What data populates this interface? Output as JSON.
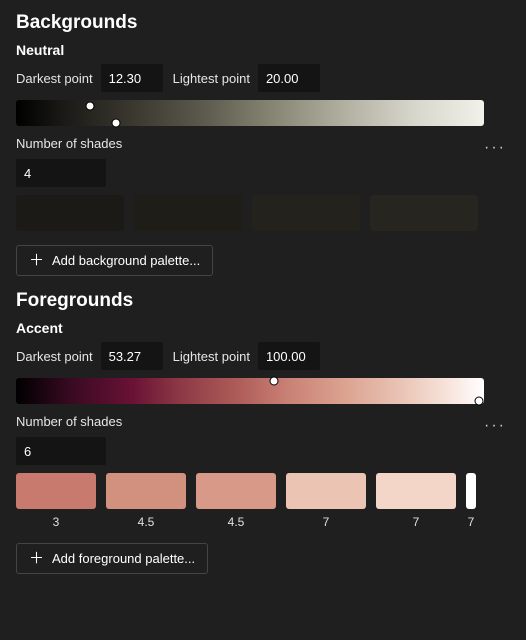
{
  "backgrounds": {
    "title": "Backgrounds",
    "palette_name": "Neutral",
    "darkest_label": "Darkest point",
    "darkest_value": "12.30",
    "lightest_label": "Lightest point",
    "lightest_value": "20.00",
    "shades_label": "Number of shades",
    "shades_value": "4",
    "add_button": "Add background palette...",
    "gradient_css": "linear-gradient(90deg,#000000 0%,#1a1916 10%,#3a382f 25%,#5c5a4d 40%,#878573 55%,#b1afa0 70%,#d7d6cb 85%,#f2f1ea 100%)",
    "handle1_x": "74",
    "handle1_y": "6",
    "handle2_x": "100",
    "handle2_y": "23",
    "swatches": [
      {
        "color": "#1b1a17"
      },
      {
        "color": "#1f1d18"
      },
      {
        "color": "#24221d"
      },
      {
        "color": "#27251f"
      }
    ]
  },
  "foregrounds": {
    "title": "Foregrounds",
    "palette_name": "Accent",
    "darkest_label": "Darkest point",
    "darkest_value": "53.27",
    "lightest_label": "Lightest point",
    "lightest_value": "100.00",
    "shades_label": "Number of shades",
    "shades_value": "6",
    "add_button": "Add foreground palette...",
    "gradient_css": "linear-gradient(90deg,#000000 0%,#3a0a22 12%,#6a1236 25%,#8d3845 35%,#b05e5a 48%,#c98075 58%,#dba290 70%,#e9c3b5 82%,#f6e3d9 92%,#ffffff 100%)",
    "handle1_x": "258",
    "handle1_y": "3",
    "handle2_x": "463",
    "handle2_y": "23",
    "swatches": [
      {
        "color": "#c77a6d",
        "label": "3"
      },
      {
        "color": "#d2907f",
        "label": "4.5"
      },
      {
        "color": "#d99988",
        "label": "4.5"
      },
      {
        "color": "#ecc4b4",
        "label": "7"
      },
      {
        "color": "#f3d6c8",
        "label": "7"
      },
      {
        "color": "#ffffff",
        "label": "7",
        "last": true
      }
    ]
  }
}
